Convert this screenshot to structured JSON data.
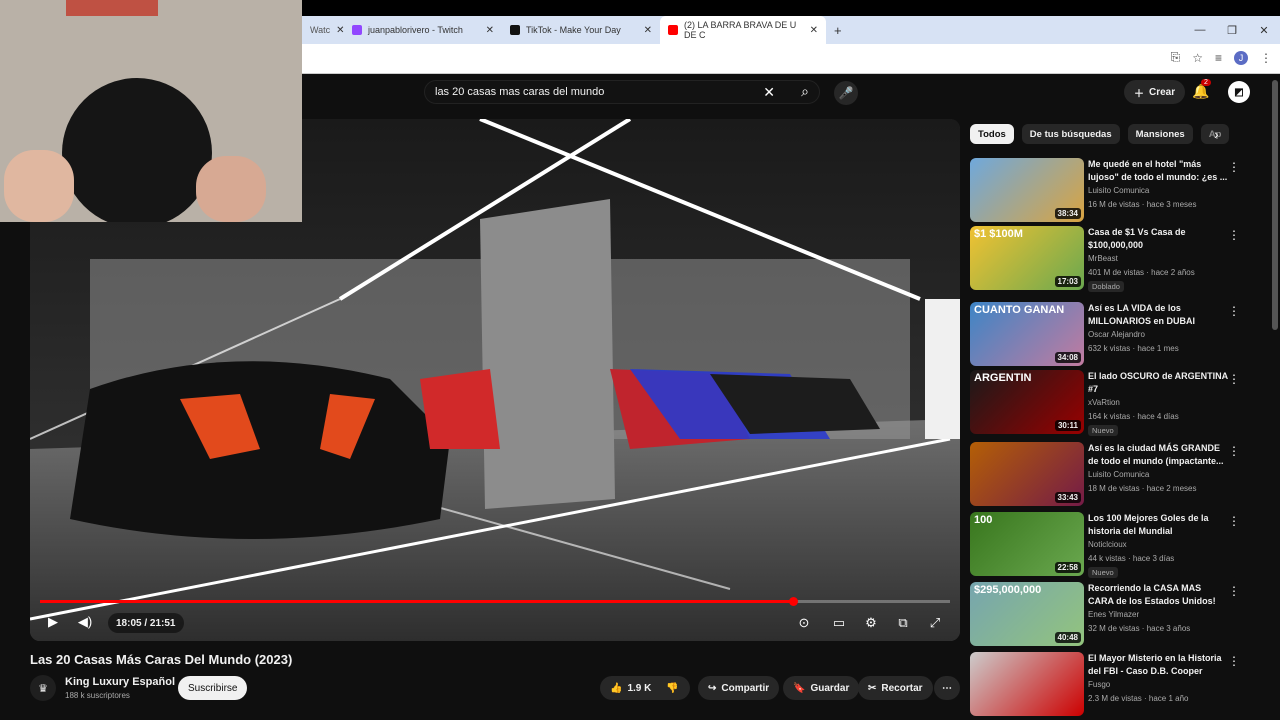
{
  "browser": {
    "tabs": [
      {
        "label": "Watc",
        "color": "#9147ff"
      },
      {
        "label": "juanpablorivero - Twitch",
        "color": "#9147ff"
      },
      {
        "label": "TikTok - Make Your Day",
        "color": "#111111"
      },
      {
        "label": "(2) LA BARRA BRAVA DE U DE C",
        "color": "#ff0000"
      }
    ],
    "new_tab": "+",
    "account_initial": "J"
  },
  "header": {
    "search_value": "las 20 casas mas caras del mundo",
    "create_label": "Crear",
    "notif_count": "2"
  },
  "player": {
    "time": "18:05 / 21:51",
    "progress": 0.827
  },
  "video": {
    "title": "Las 20 Casas Más Caras Del Mundo (2023)",
    "channel": "King Luxury Español",
    "subs": "188 k suscriptores",
    "subscribe_label": "Suscribirse",
    "likes": "1.9 K",
    "share_label": "Compartir",
    "save_label": "Guardar",
    "clip_label": "Recortar"
  },
  "chips": [
    "Todos",
    "De tus búsquedas",
    "Mansiones",
    "Ap"
  ],
  "recommendations": [
    {
      "title": "Me quedé en el hotel \"más lujoso\" de todo el mundo: ¿es ...",
      "channel": "Luisito Comunica",
      "meta": "16 M de vistas · hace 3 meses",
      "duration": "38:34",
      "badge": "",
      "color1": "#6fa8dc",
      "color2": "#d9a441"
    },
    {
      "title": "Casa de $1 Vs Casa de $100,000,000",
      "channel": "MrBeast",
      "meta": "401 M de vistas · hace 2 años",
      "duration": "17:03",
      "badge": "Doblado",
      "color1": "#f1c232",
      "color2": "#6aa84f"
    },
    {
      "title": "Así es LA VIDA de los MILLONARIOS en DUBAI",
      "channel": "Oscar Alejandro",
      "meta": "632 k vistas · hace 1 mes",
      "duration": "34:08",
      "badge": "",
      "color1": "#3d85c6",
      "color2": "#c27ba0"
    },
    {
      "title": "El lado OSCURO de ARGENTINA #7",
      "channel": "xVaRtion",
      "meta": "164 k vistas · hace 4 días",
      "duration": "30:11",
      "badge": "Nuevo",
      "color1": "#1a1a1a",
      "color2": "#990000"
    },
    {
      "title": "Así es la ciudad MÁS GRANDE de todo el mundo (impactante...",
      "channel": "Luisito Comunica",
      "meta": "18 M de vistas · hace 2 meses",
      "duration": "33:43",
      "badge": "",
      "color1": "#b45f06",
      "color2": "#741b47"
    },
    {
      "title": "Los 100 Mejores Goles de la historia del Mundial",
      "channel": "Noticlcioux",
      "meta": "44 k vistas · hace 3 días",
      "duration": "22:58",
      "badge": "Nuevo",
      "color1": "#38761d",
      "color2": "#6aa84f"
    },
    {
      "title": "Recorriendo la CASA MAS CARA de los Estados Unidos!",
      "channel": "Enes Yilmazer",
      "meta": "32 M de vistas · hace 3 años",
      "duration": "40:48",
      "badge": "",
      "color1": "#76a5af",
      "color2": "#93c47d"
    },
    {
      "title": "El Mayor Misterio en la Historia del FBI - Caso D.B. Cooper",
      "channel": "Fusgo",
      "meta": "2.3 M de vistas · hace 1 año",
      "duration": "",
      "badge": "",
      "color1": "#cccccc",
      "color2": "#cc0000"
    }
  ],
  "thumb_texts": [
    "",
    "$1   $100M",
    "CUANTO GANAN",
    "ARGENTIN",
    "",
    "100",
    "$295,000,000",
    ""
  ]
}
